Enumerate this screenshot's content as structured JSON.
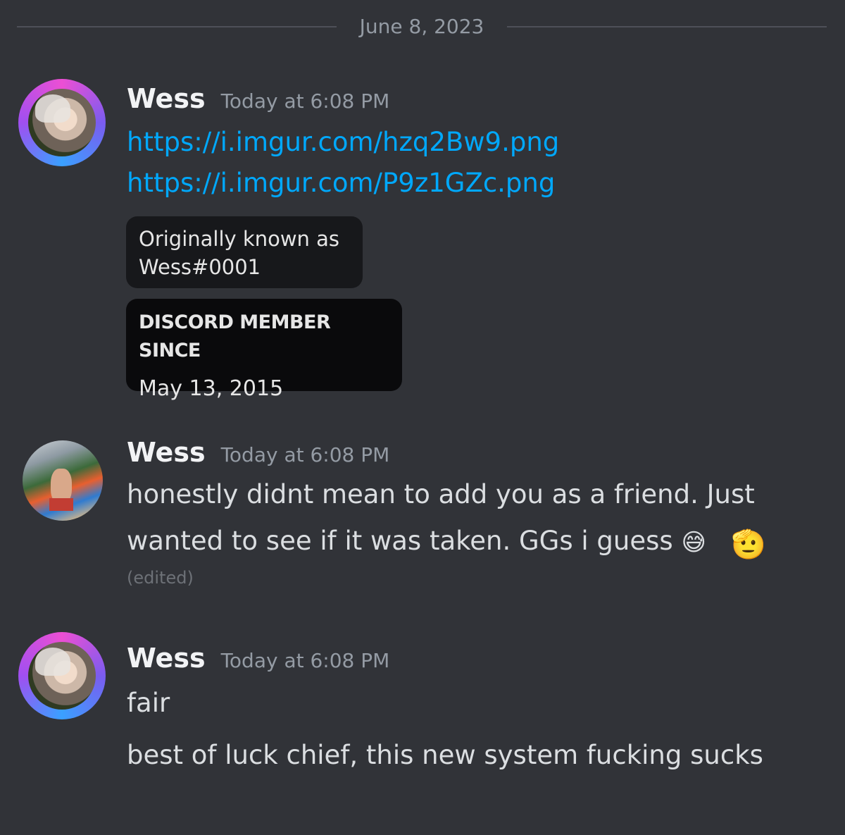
{
  "date_divider": "June 8, 2023",
  "messages": [
    {
      "username": "Wess",
      "timestamp": "Today at 6:08 PM",
      "links": [
        "https://i.imgur.com/hzq2Bw9.png",
        "https://i.imgur.com/P9z1GZc.png"
      ],
      "card_known": {
        "line1": "Originally known as",
        "line2": "Wess#0001"
      },
      "card_member": {
        "heading": "DISCORD MEMBER SINCE",
        "value": "May 13, 2015"
      }
    },
    {
      "username": "Wess",
      "timestamp": "Today at 6:08 PM",
      "line1": "honestly didnt mean to add you as a friend. Just",
      "line2": "wanted to see if it was taken. GGs i guess",
      "emoji1": "😅",
      "emoji2": "🫡",
      "edited": "(edited)"
    },
    {
      "username": "Wess",
      "timestamp": "Today at 6:08 PM",
      "line1": "fair",
      "line2": "best of luck chief, this new system fucking sucks"
    }
  ]
}
